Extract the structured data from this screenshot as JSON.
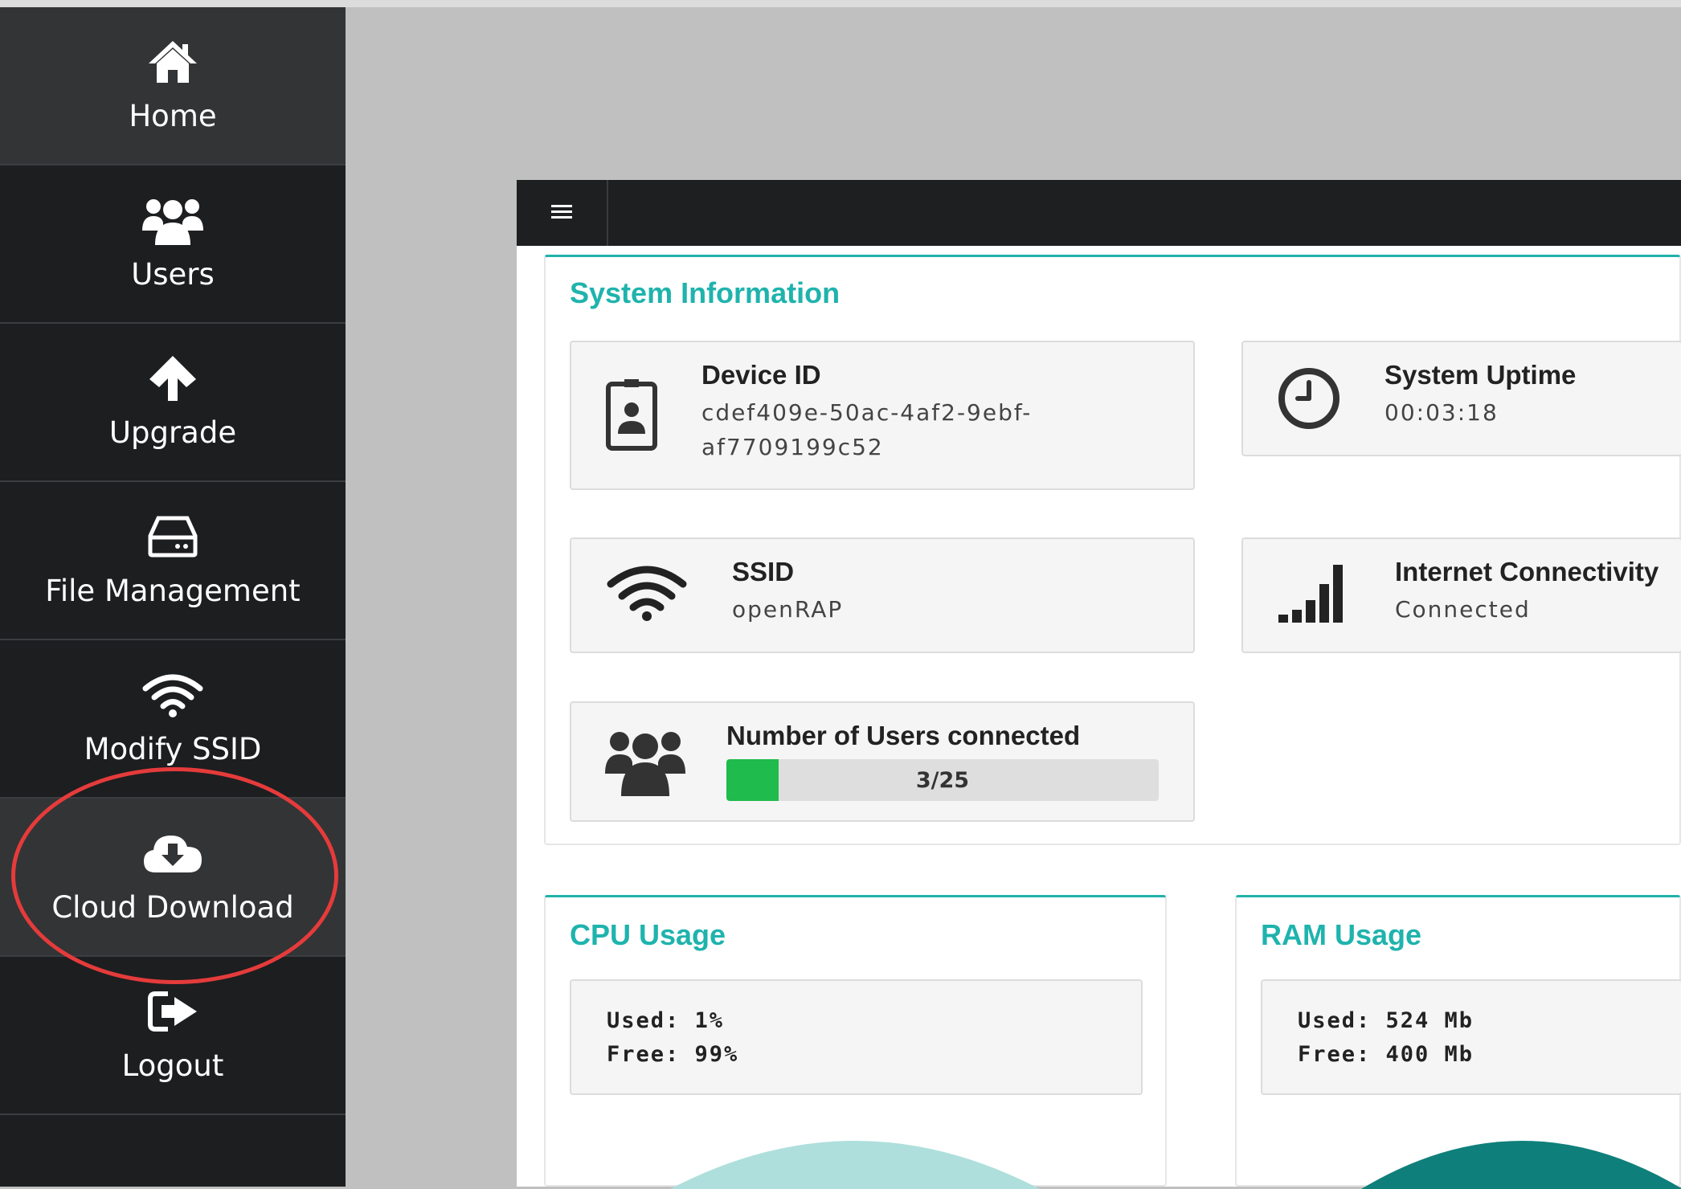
{
  "sidebar": {
    "items": [
      {
        "label": "Home",
        "icon": "home-icon",
        "active": true
      },
      {
        "label": "Users",
        "icon": "users-icon"
      },
      {
        "label": "Upgrade",
        "icon": "arrow-up-icon"
      },
      {
        "label": "File Management",
        "icon": "hard-drive-icon"
      },
      {
        "label": "Modify SSID",
        "icon": "wifi-icon"
      },
      {
        "label": "Cloud Download",
        "icon": "cloud-download-icon",
        "highlighted": true
      },
      {
        "label": "Logout",
        "icon": "sign-out-icon"
      }
    ]
  },
  "topbar": {
    "menu_icon": "hamburger-icon"
  },
  "system_info": {
    "title": "System Information",
    "device_id": {
      "label": "Device ID",
      "value_line1": "cdef409e-50ac-4af2-9ebf-",
      "value_line2": "af7709199c52",
      "icon": "id-badge-icon"
    },
    "uptime": {
      "label": "System Uptime",
      "value": "00:03:18",
      "icon": "clock-icon"
    },
    "ssid": {
      "label": "SSID",
      "value": "openRAP",
      "icon": "wifi-icon"
    },
    "internet": {
      "label": "Internet Connectivity",
      "value": "Connected",
      "icon": "signal-bars-icon"
    },
    "users_connected": {
      "label": "Number of Users connected",
      "text": "3/25",
      "current": 3,
      "max": 25,
      "icon": "users-icon"
    }
  },
  "cpu": {
    "title": "CPU Usage",
    "used": "Used: 1%",
    "free": "Free: 99%",
    "used_fraction": 0.01
  },
  "ram": {
    "title": "RAM Usage",
    "used": "Used: 524 Mb",
    "free": "Free: 400 Mb"
  },
  "colors": {
    "accent": "#1fb3ad",
    "sidebar_bg": "#1d1e20",
    "progress": "#1fbb4c",
    "highlight_ring": "#e53b3b"
  }
}
